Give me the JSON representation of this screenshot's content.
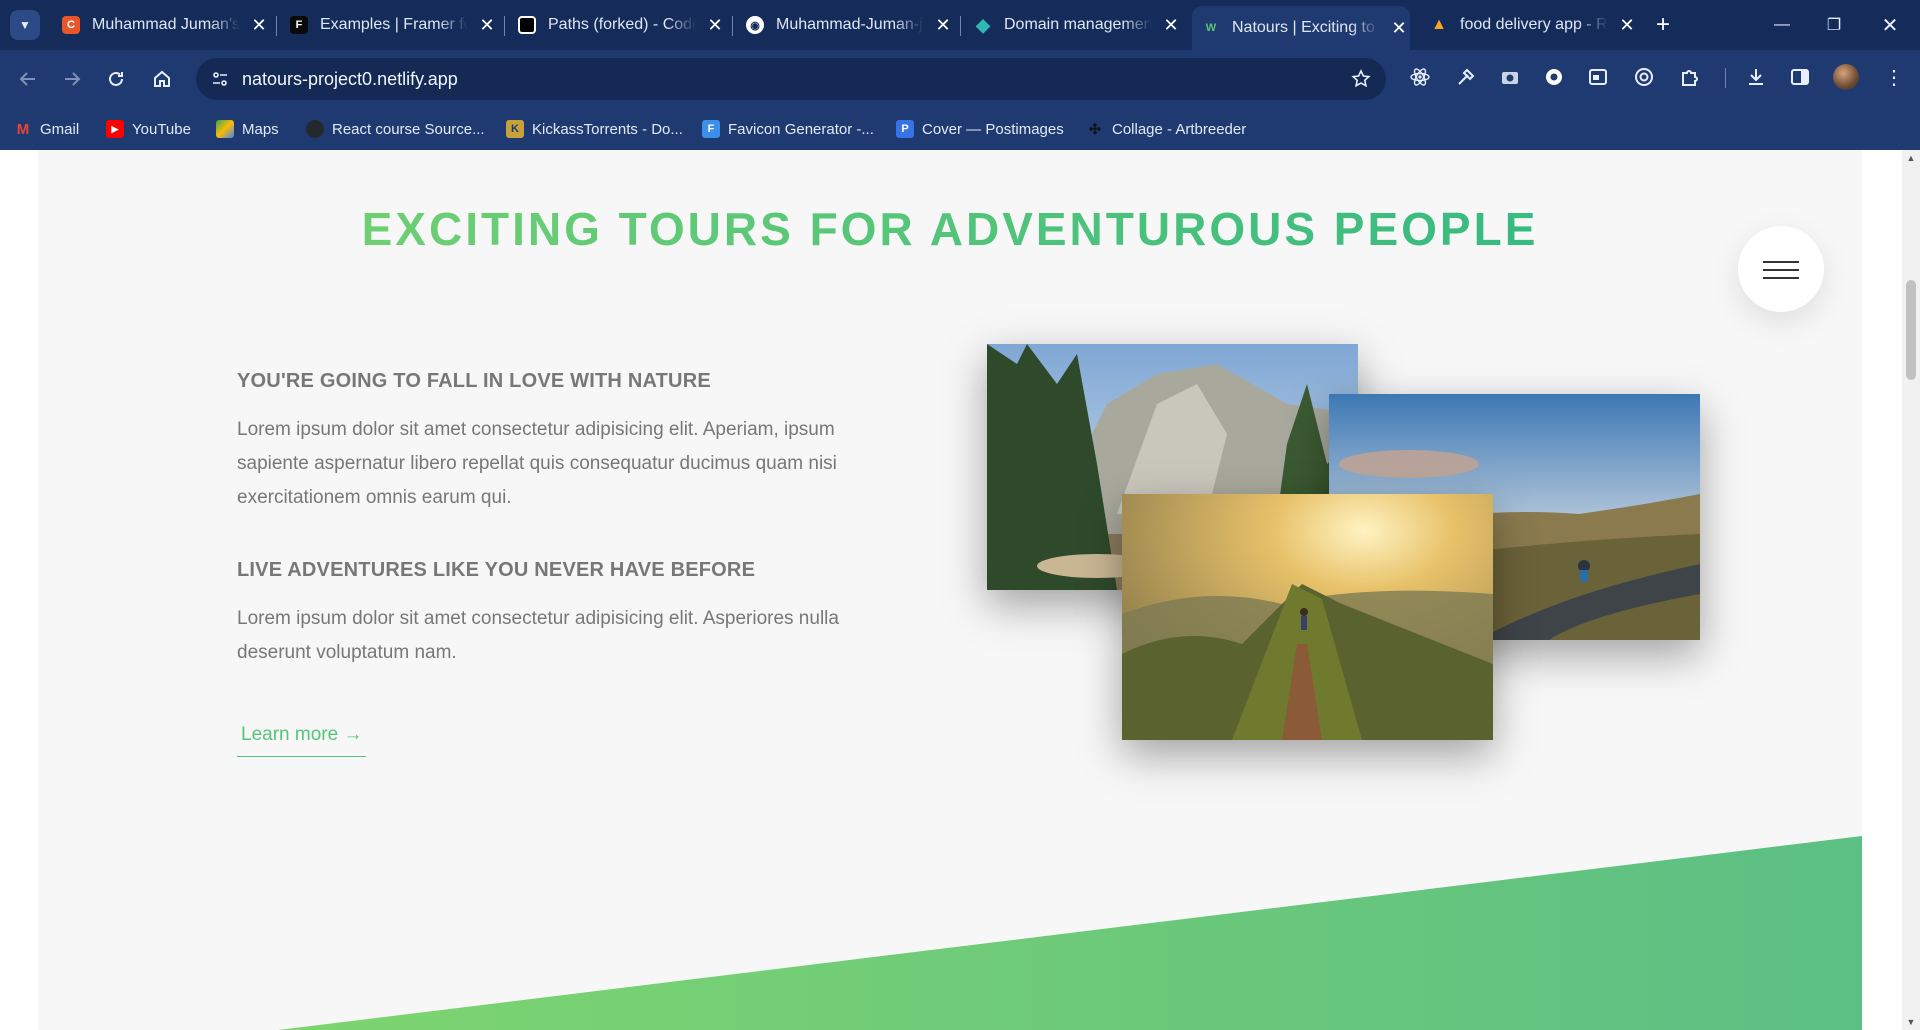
{
  "browser": {
    "tabs": [
      {
        "label": "Muhammad Juman's",
        "icon": "c-logo-icon",
        "icon_glyph": "C",
        "icon_color": "#e8562a"
      },
      {
        "label": "Examples | Framer fo",
        "icon": "framer-icon",
        "icon_glyph": "F",
        "icon_color": "#0a0a0a"
      },
      {
        "label": "Paths (forked) - Code",
        "icon": "codesandbox-icon",
        "icon_glyph": "□",
        "icon_color": "#000000"
      },
      {
        "label": "Muhammad-Juman-j",
        "icon": "github-icon",
        "icon_glyph": "●",
        "icon_color": "#ffffff"
      },
      {
        "label": "Domain managemen",
        "icon": "netlify-diamond-icon",
        "icon_glyph": "◆",
        "icon_color": "#2fb8b1"
      },
      {
        "label": "Natours | Exciting to",
        "icon": "natours-logo-icon",
        "icon_glyph": "W",
        "icon_color": "#55c57a"
      },
      {
        "label": "food delivery app - R",
        "icon": "firebase-icon",
        "icon_glyph": "🔥",
        "icon_color": "#f5a623"
      }
    ],
    "active_tab": 5,
    "url": "natours-project0.netlify.app",
    "bookmarks": [
      {
        "label": "Gmail",
        "icon": "gmail-icon",
        "glyph": "M",
        "color": "#ea4335"
      },
      {
        "label": "YouTube",
        "icon": "youtube-icon",
        "glyph": "▶",
        "color": "#ff0000"
      },
      {
        "label": "Maps",
        "icon": "maps-icon",
        "glyph": "✦",
        "color": "#34a853"
      },
      {
        "label": "React course Source...",
        "icon": "github-icon",
        "glyph": "●",
        "color": "#24292e"
      },
      {
        "label": "KickassTorrents - Do...",
        "icon": "kickass-icon",
        "glyph": "K",
        "color": "#c8a13a"
      },
      {
        "label": "Favicon Generator -...",
        "icon": "favicon-generator-icon",
        "glyph": "F",
        "color": "#3b8eea"
      },
      {
        "label": "Cover — Postimages",
        "icon": "postimages-icon",
        "glyph": "P",
        "color": "#3573e6"
      },
      {
        "label": "Collage - Artbreeder",
        "icon": "artbreeder-icon",
        "glyph": "✣",
        "color": "#222222"
      }
    ]
  },
  "page": {
    "heading": "EXCITING TOURS FOR ADVENTUROUS PEOPLE",
    "features": [
      {
        "title": "YOU'RE GOING TO FALL IN LOVE WITH NATURE",
        "text": "Lorem ipsum dolor sit amet consectetur adipisicing elit. Aperiam, ipsum sapiente aspernatur libero repellat quis consequatur ducimus quam nisi exercitationem omnis earum qui."
      },
      {
        "title": "LIVE ADVENTURES LIKE YOU NEVER HAVE BEFORE",
        "text": "Lorem ipsum dolor sit amet consectetur adipisicing elit. Asperiores nulla deserunt voluptatum nam."
      }
    ],
    "learn_more": "Learn more →",
    "colors": {
      "primary_light": "#7ed56f",
      "primary_dark": "#28b485",
      "text_grey": "#777777",
      "page_bg": "#f7f7f7"
    }
  }
}
